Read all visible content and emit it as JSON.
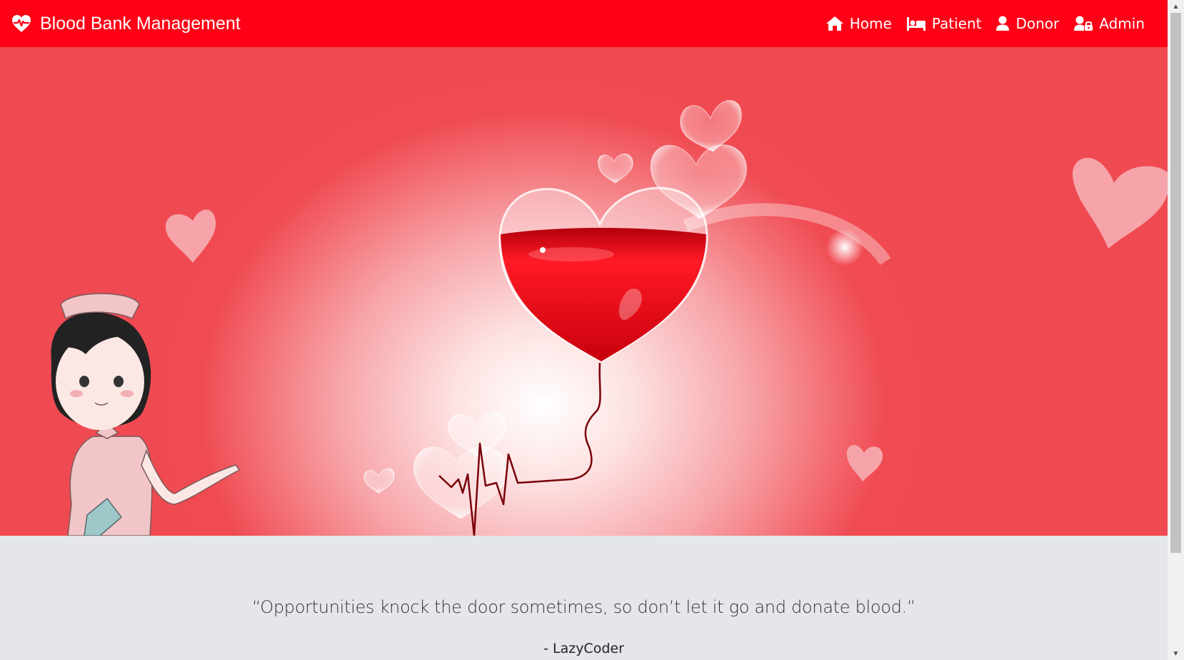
{
  "navbar": {
    "brand_icon": "heartbeat-icon",
    "brand_text": "Blood Bank Management",
    "background_color": "#ff0016",
    "links": [
      {
        "label": "Home",
        "icon": "home-icon"
      },
      {
        "label": "Patient",
        "icon": "bed-icon"
      },
      {
        "label": "Donor",
        "icon": "user-icon"
      },
      {
        "label": "Admin",
        "icon": "user-lock-icon"
      }
    ]
  },
  "hero": {
    "image": "blood-donation-banner-illustration",
    "colors": {
      "background": "#ef4a52",
      "heart_blood": "#e8101c"
    }
  },
  "quote": {
    "text": "“Opportunities knock the door sometimes, so don’t let it go and donate blood.”",
    "author": "- LazyCoder"
  }
}
